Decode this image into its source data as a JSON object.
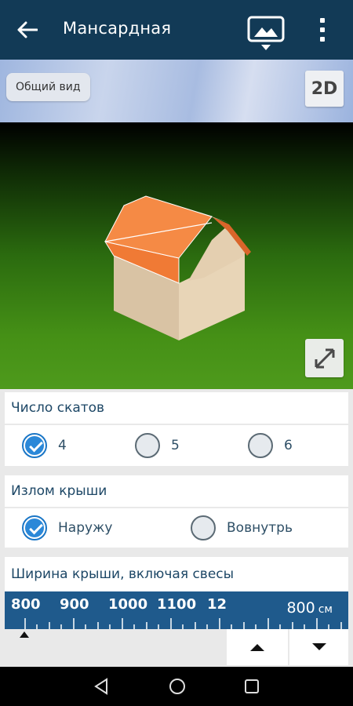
{
  "appbar": {
    "title": "Мансардная"
  },
  "viewport": {
    "view_chip": "Общий вид",
    "mode_button": "2D"
  },
  "slopes": {
    "header": "Число скатов",
    "options": [
      {
        "label": "4",
        "selected": true
      },
      {
        "label": "5",
        "selected": false
      },
      {
        "label": "6",
        "selected": false
      }
    ]
  },
  "break": {
    "header": "Излом крыши",
    "options": [
      {
        "label": "Наружу",
        "selected": true
      },
      {
        "label": "Вовнутрь",
        "selected": false
      }
    ]
  },
  "width": {
    "header": "Ширина крыши, включая свесы",
    "ruler_labels": [
      "800",
      "900",
      "1000",
      "1100",
      "12"
    ],
    "value": "800",
    "unit": "см"
  },
  "colors": {
    "appbar": "#123a56",
    "accent": "#2b88d8",
    "ruler": "#1f5a8c",
    "roof": "#f07a35"
  }
}
